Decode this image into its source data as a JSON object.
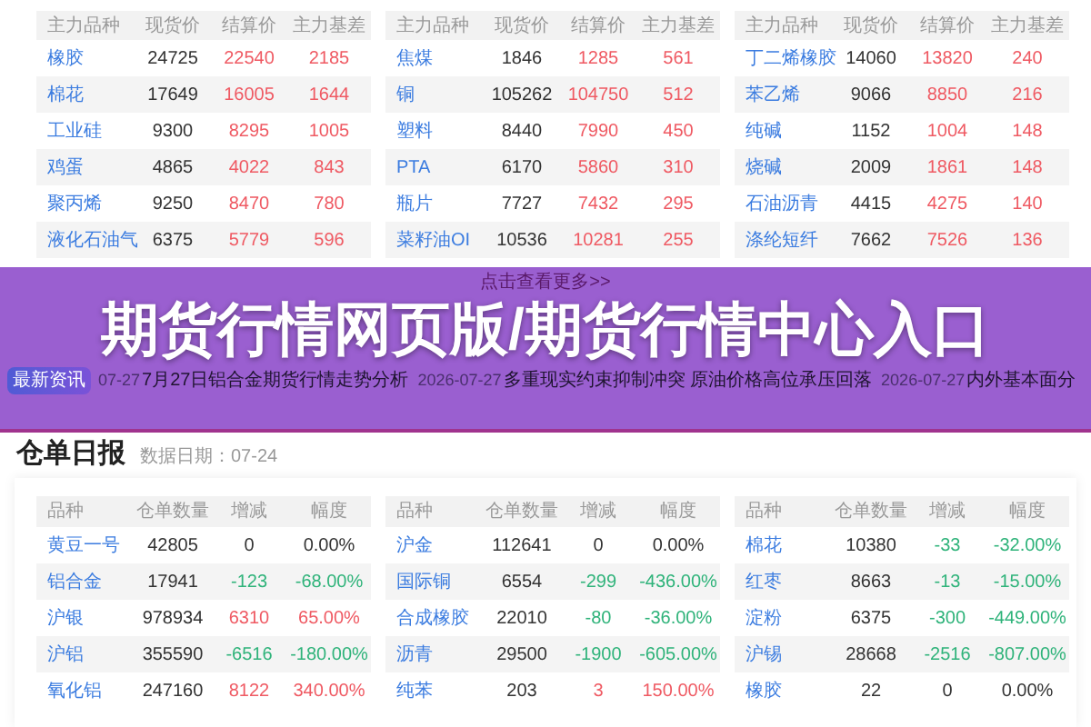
{
  "top_tables": [
    {
      "columns": [
        "主力品种",
        "现货价",
        "结算价",
        "主力基差"
      ],
      "rows": [
        [
          "橡胶",
          "24725",
          "22540",
          "2185"
        ],
        [
          "棉花",
          "17649",
          "16005",
          "1644"
        ],
        [
          "工业硅",
          "9300",
          "8295",
          "1005"
        ],
        [
          "鸡蛋",
          "4865",
          "4022",
          "843"
        ],
        [
          "聚丙烯",
          "9250",
          "8470",
          "780"
        ],
        [
          "液化石油气",
          "6375",
          "5779",
          "596"
        ]
      ]
    },
    {
      "columns": [
        "主力品种",
        "现货价",
        "结算价",
        "主力基差"
      ],
      "rows": [
        [
          "焦煤",
          "1846",
          "1285",
          "561"
        ],
        [
          "铜",
          "105262",
          "104750",
          "512"
        ],
        [
          "塑料",
          "8440",
          "7990",
          "450"
        ],
        [
          "PTA",
          "6170",
          "5860",
          "310"
        ],
        [
          "瓶片",
          "7727",
          "7432",
          "295"
        ],
        [
          "菜籽油OI",
          "10536",
          "10281",
          "255"
        ]
      ]
    },
    {
      "columns": [
        "主力品种",
        "现货价",
        "结算价",
        "主力基差"
      ],
      "rows": [
        [
          "丁二烯橡胶",
          "14060",
          "13820",
          "240"
        ],
        [
          "苯乙烯",
          "9066",
          "8850",
          "216"
        ],
        [
          "纯碱",
          "1152",
          "1004",
          "148"
        ],
        [
          "烧碱",
          "2009",
          "1861",
          "148"
        ],
        [
          "石油沥青",
          "4415",
          "4275",
          "140"
        ],
        [
          "涤纶短纤",
          "7662",
          "7526",
          "136"
        ]
      ]
    }
  ],
  "more_link": "点击查看更多>>",
  "news": {
    "badge": "最新资讯",
    "items": [
      {
        "date": "07-27",
        "title": "7月27日铝合金期货行情走势分析"
      },
      {
        "date": "2026-07-27",
        "title": "多重现实约束抑制冲突 原油价格高位承压回落"
      },
      {
        "date": "2026-07-27",
        "title": "内外基本面分"
      }
    ]
  },
  "banner": {
    "title": "期货行情网页版/期货行情中心入口"
  },
  "warehouse": {
    "title": "仓单日报",
    "date": "数据日期：07-24",
    "tables": [
      {
        "columns": [
          "品种",
          "仓单数量",
          "增减",
          "幅度"
        ],
        "rows": [
          {
            "name": "黄豆一号",
            "qty": "42805",
            "change": "0",
            "pct": "0.00%",
            "color": "#333333"
          },
          {
            "name": "铝合金",
            "qty": "17941",
            "change": "-123",
            "pct": "-68.00%",
            "color": "#2fb37a"
          },
          {
            "name": "沪银",
            "qty": "978934",
            "change": "6310",
            "pct": "65.00%",
            "color": "#ef5a63"
          },
          {
            "name": "沪铝",
            "qty": "355590",
            "change": "-6516",
            "pct": "-180.00%",
            "color": "#2fb37a"
          },
          {
            "name": "氧化铝",
            "qty": "247160",
            "change": "8122",
            "pct": "340.00%",
            "color": "#ef5a63"
          }
        ]
      },
      {
        "columns": [
          "品种",
          "仓单数量",
          "增减",
          "幅度"
        ],
        "rows": [
          {
            "name": "沪金",
            "qty": "112641",
            "change": "0",
            "pct": "0.00%",
            "color": "#333333"
          },
          {
            "name": "国际铜",
            "qty": "6554",
            "change": "-299",
            "pct": "-436.00%",
            "color": "#2fb37a"
          },
          {
            "name": "合成橡胶",
            "qty": "22010",
            "change": "-80",
            "pct": "-36.00%",
            "color": "#2fb37a"
          },
          {
            "name": "沥青",
            "qty": "29500",
            "change": "-1900",
            "pct": "-605.00%",
            "color": "#2fb37a"
          },
          {
            "name": "纯苯",
            "qty": "203",
            "change": "3",
            "pct": "150.00%",
            "color": "#ef5a63"
          }
        ]
      },
      {
        "columns": [
          "品种",
          "仓单数量",
          "增减",
          "幅度"
        ],
        "rows": [
          {
            "name": "棉花",
            "qty": "10380",
            "change": "-33",
            "pct": "-32.00%",
            "color": "#2fb37a"
          },
          {
            "name": "红枣",
            "qty": "8663",
            "change": "-13",
            "pct": "-15.00%",
            "color": "#2fb37a"
          },
          {
            "name": "淀粉",
            "qty": "6375",
            "change": "-300",
            "pct": "-449.00%",
            "color": "#2fb37a"
          },
          {
            "name": "沪锡",
            "qty": "28668",
            "change": "-2516",
            "pct": "-807.00%",
            "color": "#2fb37a"
          },
          {
            "name": "橡胶",
            "qty": "22",
            "change": "0",
            "pct": "0.00%",
            "color": "#333333"
          }
        ]
      }
    ]
  }
}
